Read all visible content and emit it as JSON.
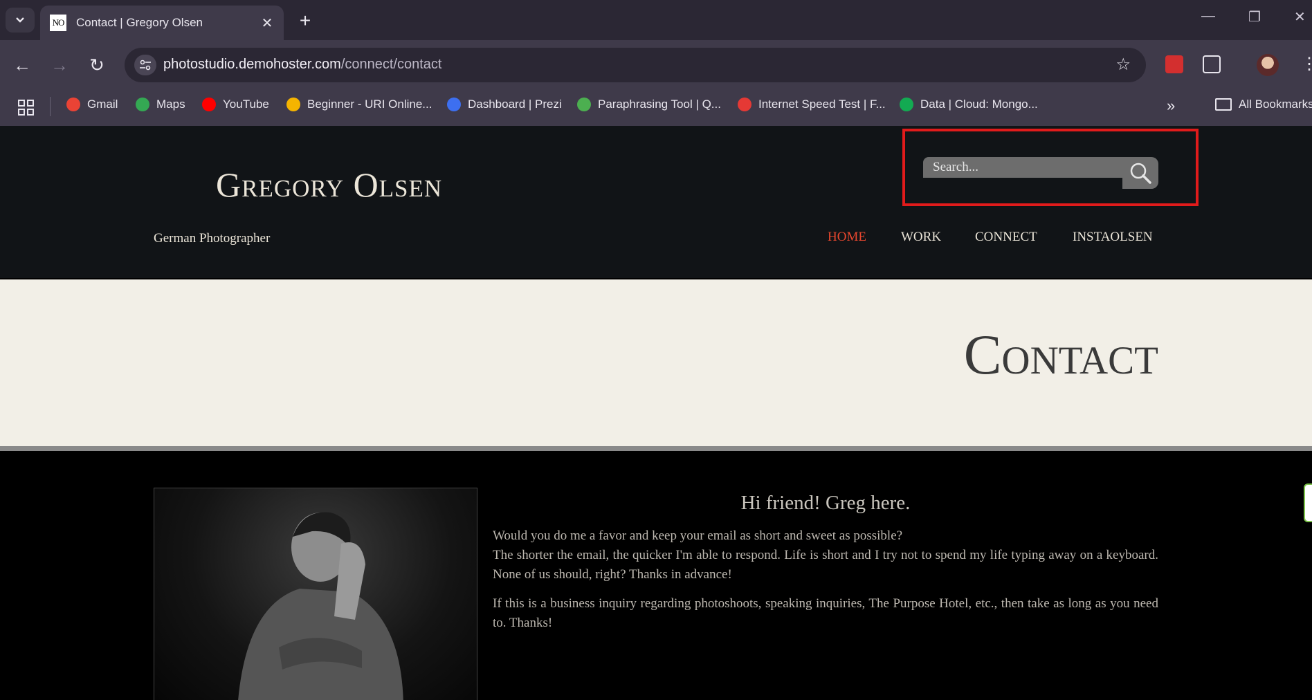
{
  "browser": {
    "tab_title": "Contact | Gregory Olsen",
    "favicon_text": "NO",
    "url_host": "photostudio.demohoster.com",
    "url_path": "/connect/contact",
    "bookmarks": [
      {
        "label": "Gmail",
        "icon": "gmail-icon",
        "color": "#ea4335"
      },
      {
        "label": "Maps",
        "icon": "maps-icon",
        "color": "#34a853"
      },
      {
        "label": "YouTube",
        "icon": "youtube-icon",
        "color": "#ff0000"
      },
      {
        "label": "Beginner - URI Online...",
        "icon": "uri-icon",
        "color": "#f5b400"
      },
      {
        "label": "Dashboard | Prezi",
        "icon": "prezi-icon",
        "color": "#3d6ff0"
      },
      {
        "label": "Paraphrasing Tool | Q...",
        "icon": "quillbot-icon",
        "color": "#4caf50"
      },
      {
        "label": "Internet Speed Test | F...",
        "icon": "speedtest-icon",
        "color": "#e53935"
      },
      {
        "label": "Data | Cloud: Mongo...",
        "icon": "mongodb-icon",
        "color": "#13aa52"
      }
    ],
    "all_bookmarks": "All Bookmarks"
  },
  "site": {
    "title": "Gregory Olsen",
    "tagline": "German Photographer",
    "search_placeholder": "Search...",
    "nav": [
      {
        "label": "HOME",
        "active": true
      },
      {
        "label": "WORK",
        "active": false
      },
      {
        "label": "CONNECT",
        "active": false
      },
      {
        "label": "INSTAOLSEN",
        "active": false
      }
    ],
    "accent_color": "#e8472e"
  },
  "banner": {
    "title": "Contact"
  },
  "content": {
    "greeting": "Hi friend! Greg here.",
    "para1_line1": "Would you do me a favor and keep your email as short and sweet as possible?",
    "para1_line2": "The shorter the email, the quicker I'm able to respond. Life is short and I try not to spend my life typing away on a keyboard. None of us should, right? Thanks in advance!",
    "para2": "If this is a business inquiry regarding photoshoots, speaking inquiries, The Purpose Hotel, etc., then take as long as you need to. Thanks!"
  }
}
